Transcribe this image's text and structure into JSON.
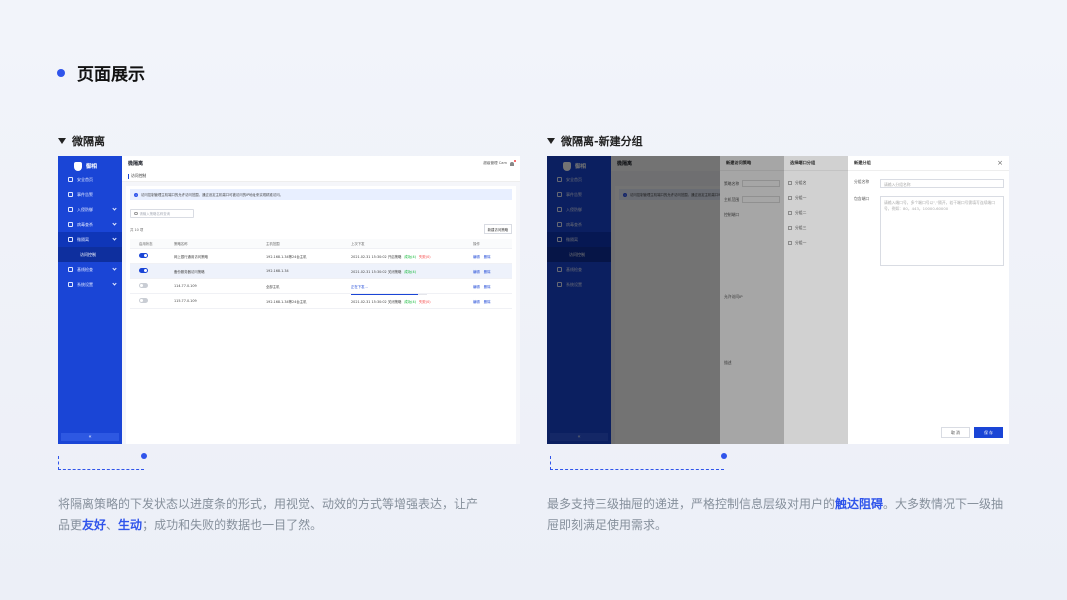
{
  "page": {
    "title": "页面展示"
  },
  "sections": {
    "left": {
      "label": "微隔离"
    },
    "right": {
      "label": "微隔离-新建分组"
    }
  },
  "app": {
    "brand": "御相",
    "topbar": {
      "title": "微隔离",
      "user": "超级管理 Cam"
    },
    "breadcrumb": "访问控制",
    "sidebar": {
      "items": [
        {
          "label": "安全首页"
        },
        {
          "label": "事件告警"
        },
        {
          "label": "入侵防御"
        },
        {
          "label": "病毒查杀"
        },
        {
          "label": "微隔离"
        },
        {
          "label": "访问控制"
        },
        {
          "label": "基线检查"
        },
        {
          "label": "系统设置"
        }
      ],
      "collapse": "«"
    },
    "notice": "访问控制管理主机端口的允许访问范围，通过设定主机端口可被访问的IP地址来实现精准访问。",
    "search_placeholder": "请输入策略名称查询",
    "count": "共 10 项",
    "new_button": "新建访问策略",
    "table": {
      "headers": [
        "启用状态",
        "策略名称",
        "主机范围",
        "上次下发",
        "操作"
      ],
      "rows": [
        {
          "enabled": true,
          "name": "网上银行通用访问策略",
          "hosts": "192.168.1.34等24台主机",
          "time": "2021.02.31 15:30:02",
          "mode": "开启策略",
          "ok": "成功(4)",
          "fail": "失败(0)",
          "edit": "编辑",
          "del": "删除"
        },
        {
          "enabled": true,
          "name": "备份服务器访问策略",
          "hosts": "192.168.1.34",
          "time": "2021.02.31 15:30:02",
          "mode": "关闭策略",
          "ok": "成功(4)",
          "fail": "",
          "edit": "编辑",
          "del": "删除"
        },
        {
          "enabled": false,
          "name": "114.77.0.109",
          "hosts": "全部主机",
          "time": "",
          "mode": "正在下发...",
          "ok": "",
          "fail": "",
          "progress": 0.88,
          "edit": "编辑",
          "del": "删除"
        },
        {
          "enabled": false,
          "name": "115.77.0.109",
          "hosts": "192.168.1.34等24台主机",
          "time": "2021.02.31 15:30:02",
          "mode": "关闭策略",
          "ok": "成功(4)",
          "fail": "失败(0)",
          "edit": "编辑",
          "del": "删除"
        }
      ]
    }
  },
  "drawers": {
    "d1": {
      "title": "新建访问策略",
      "fields": [
        "策略名称",
        "主机范围",
        "控制端口",
        "允许访问IP",
        "描述"
      ]
    },
    "d2": {
      "title": "选择端口分组",
      "groups": [
        "分组名",
        "分组一",
        "分组二",
        "分组三",
        "分组一"
      ]
    },
    "d3": {
      "title": "新建分组",
      "name_label": "分组名称",
      "name_placeholder": "请输入分组名称",
      "port_label": "包含端口",
      "port_placeholder": "请输入端口号，多个端口号以\",\"隔开，若干端口号需填写连续端口号，例如：80，443，10000-60000",
      "cancel": "取 消",
      "save": "保 存"
    }
  },
  "descriptions": {
    "left": {
      "p1": "将隔离策略的下发状态以进度条的形式，用视觉、动效的方式等增强表达，让产品更",
      "h1": "友好",
      "p2": "、",
      "h2": "生动",
      "p3": "；成功和失败的数据也一目了然。"
    },
    "right": {
      "p1": "最多支持三级抽屉的递进，严格控制信息层级对用户的",
      "h1": "触达阻碍",
      "p2": "。大多数情况下一级抽屉即刻满足使用需求。"
    }
  },
  "colors": {
    "accent": "#2f54eb",
    "sidebar": "#1a45d6",
    "success": "#00b42a",
    "danger": "#f53f3f"
  }
}
